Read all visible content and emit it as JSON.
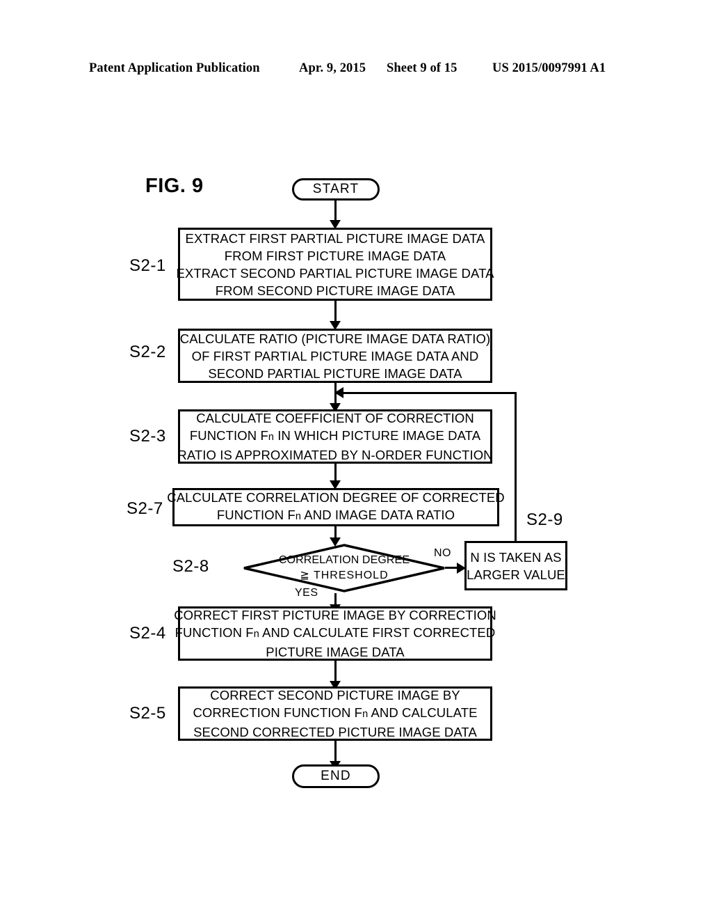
{
  "header": {
    "publication": "Patent Application Publication",
    "date": "Apr. 9, 2015",
    "sheet": "Sheet 9 of 15",
    "patent_number": "US 2015/0097991 A1"
  },
  "figure": {
    "label": "FIG. 9"
  },
  "flow": {
    "start": "START",
    "end": "END",
    "steps": [
      {
        "id": "S2-1",
        "lines": [
          "EXTRACT FIRST PARTIAL PICTURE IMAGE DATA",
          "FROM FIRST PICTURE IMAGE DATA",
          "EXTRACT SECOND PARTIAL PICTURE IMAGE DATA",
          "FROM SECOND PICTURE IMAGE DATA"
        ]
      },
      {
        "id": "S2-2",
        "lines": [
          "CALCULATE RATIO (PICTURE IMAGE DATA RATIO)",
          "OF FIRST PARTIAL PICTURE IMAGE DATA AND",
          "SECOND PARTIAL PICTURE IMAGE DATA"
        ]
      },
      {
        "id": "S2-3",
        "lines": [
          "CALCULATE COEFFICIENT OF CORRECTION",
          "FUNCTION Fn IN WHICH PICTURE IMAGE DATA",
          "RATIO IS APPROXIMATED BY N-ORDER FUNCTION"
        ]
      },
      {
        "id": "S2-7",
        "lines": [
          "CALCULATE CORRELATION DEGREE OF CORRECTED",
          "FUNCTION Fn AND IMAGE DATA RATIO"
        ]
      },
      {
        "id": "S2-8",
        "lines": [
          "CORRELATION DEGREE",
          "≧  THRESHOLD"
        ]
      },
      {
        "id": "S2-9",
        "lines": [
          "N IS TAKEN AS",
          "LARGER VALUE"
        ]
      },
      {
        "id": "S2-4",
        "lines": [
          "CORRECT FIRST PICTURE IMAGE BY CORRECTION",
          "FUNCTION Fn AND CALCULATE FIRST CORRECTED",
          "PICTURE IMAGE DATA"
        ]
      },
      {
        "id": "S2-5",
        "lines": [
          "CORRECT SECOND PICTURE IMAGE BY",
          "CORRECTION FUNCTION Fn AND CALCULATE",
          "SECOND CORRECTED PICTURE IMAGE DATA"
        ]
      }
    ],
    "branches": {
      "yes": "YES",
      "no": "NO"
    }
  }
}
